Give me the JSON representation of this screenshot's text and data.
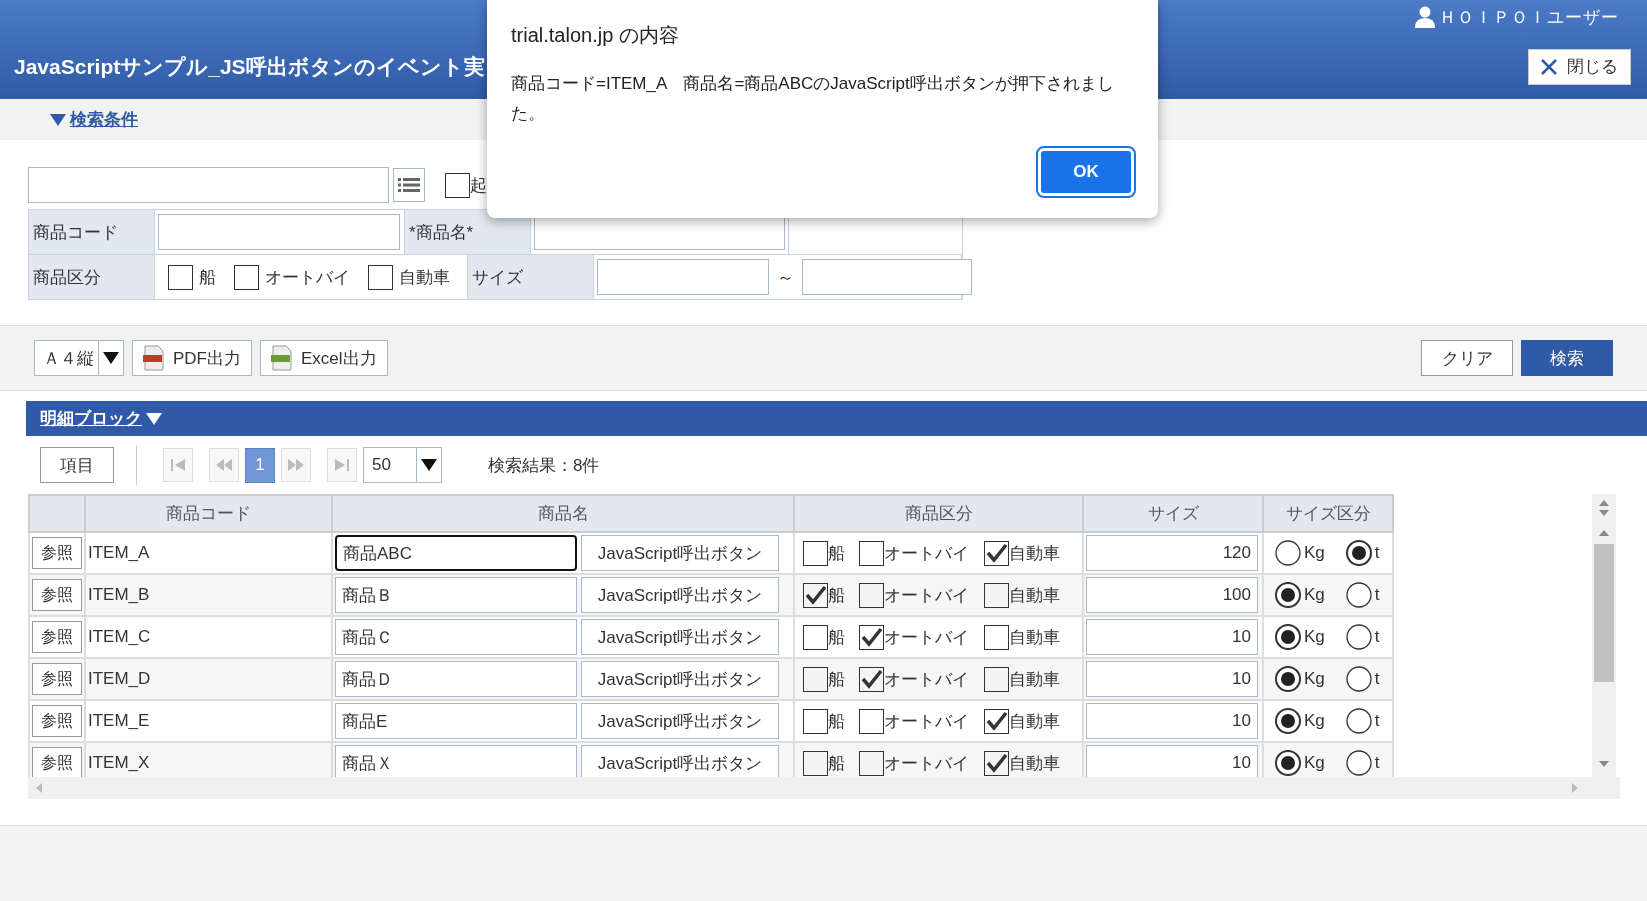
{
  "header": {
    "title": "JavaScriptサンプル_JS呼出ボタンのイベント実",
    "user": "ＨＯＩＰＯＩユーザー",
    "close_button": "閉じる"
  },
  "search": {
    "toggle": "検索条件",
    "option_label": "起",
    "option_checked": false,
    "form": {
      "code_label": "商品コード",
      "name_label": "*商品名*",
      "category_label": "商品区分",
      "categories": [
        {
          "label": "船",
          "checked": false
        },
        {
          "label": "オートバイ",
          "checked": false
        },
        {
          "label": "自動車",
          "checked": false
        }
      ],
      "size_label": "サイズ",
      "range_separator": "～"
    }
  },
  "toolbar": {
    "paper": "Ａ４縦",
    "exports": [
      {
        "kind": "pdf",
        "label": "PDF出力"
      },
      {
        "kind": "excel",
        "label": "Excel出力"
      }
    ],
    "clear_button": "クリア",
    "search_button": "検索"
  },
  "detail": {
    "title": "明細ブロック",
    "columns_button": "項目",
    "pages": [
      {
        "label": "1",
        "selected": true
      }
    ],
    "page_size": "50",
    "result": "検索結果：8件"
  },
  "table": {
    "columns": [
      "商品コード",
      "商品名",
      "商品区分",
      "サイズ",
      "サイズ区分"
    ],
    "rows": [
      {
        "ref": "参照",
        "code": "ITEM_A",
        "name": "商品ABC",
        "focused": true,
        "action": "JavaScript呼出ボタン",
        "categories": [
          {
            "label": "船",
            "checked": false
          },
          {
            "label": "オートバイ",
            "checked": false
          },
          {
            "label": "自動車",
            "checked": true
          }
        ],
        "size": "120",
        "units": [
          {
            "label": "Kg",
            "selected": false
          },
          {
            "label": "t",
            "selected": true
          }
        ]
      },
      {
        "ref": "参照",
        "code": "ITEM_B",
        "name": "商品Ｂ",
        "focused": false,
        "action": "JavaScript呼出ボタン",
        "categories": [
          {
            "label": "船",
            "checked": true
          },
          {
            "label": "オートバイ",
            "checked": false
          },
          {
            "label": "自動車",
            "checked": false
          }
        ],
        "size": "100",
        "units": [
          {
            "label": "Kg",
            "selected": true
          },
          {
            "label": "t",
            "selected": false
          }
        ]
      },
      {
        "ref": "参照",
        "code": "ITEM_C",
        "name": "商品Ｃ",
        "focused": false,
        "action": "JavaScript呼出ボタン",
        "categories": [
          {
            "label": "船",
            "checked": false
          },
          {
            "label": "オートバイ",
            "checked": true
          },
          {
            "label": "自動車",
            "checked": false
          }
        ],
        "size": "10",
        "units": [
          {
            "label": "Kg",
            "selected": true
          },
          {
            "label": "t",
            "selected": false
          }
        ]
      },
      {
        "ref": "参照",
        "code": "ITEM_D",
        "name": "商品Ｄ",
        "focused": false,
        "action": "JavaScript呼出ボタン",
        "categories": [
          {
            "label": "船",
            "checked": false
          },
          {
            "label": "オートバイ",
            "checked": true
          },
          {
            "label": "自動車",
            "checked": false
          }
        ],
        "size": "10",
        "units": [
          {
            "label": "Kg",
            "selected": true
          },
          {
            "label": "t",
            "selected": false
          }
        ]
      },
      {
        "ref": "参照",
        "code": "ITEM_E",
        "name": "商品E",
        "focused": false,
        "action": "JavaScript呼出ボタン",
        "categories": [
          {
            "label": "船",
            "checked": false
          },
          {
            "label": "オートバイ",
            "checked": false
          },
          {
            "label": "自動車",
            "checked": true
          }
        ],
        "size": "10",
        "units": [
          {
            "label": "Kg",
            "selected": true
          },
          {
            "label": "t",
            "selected": false
          }
        ]
      },
      {
        "ref": "参照",
        "code": "ITEM_X",
        "name": "商品Ｘ",
        "focused": false,
        "action": "JavaScript呼出ボタン",
        "categories": [
          {
            "label": "船",
            "checked": false
          },
          {
            "label": "オートバイ",
            "checked": false
          },
          {
            "label": "自動車",
            "checked": true
          }
        ],
        "size": "10",
        "units": [
          {
            "label": "Kg",
            "selected": true
          },
          {
            "label": "t",
            "selected": false
          }
        ]
      }
    ]
  },
  "dialog": {
    "title": "trial.talon.jp の内容",
    "message": "商品コード=ITEM_A　商品名=商品ABCのJavaScript呼出ボタンが押下されました。",
    "ok_button": "OK"
  }
}
